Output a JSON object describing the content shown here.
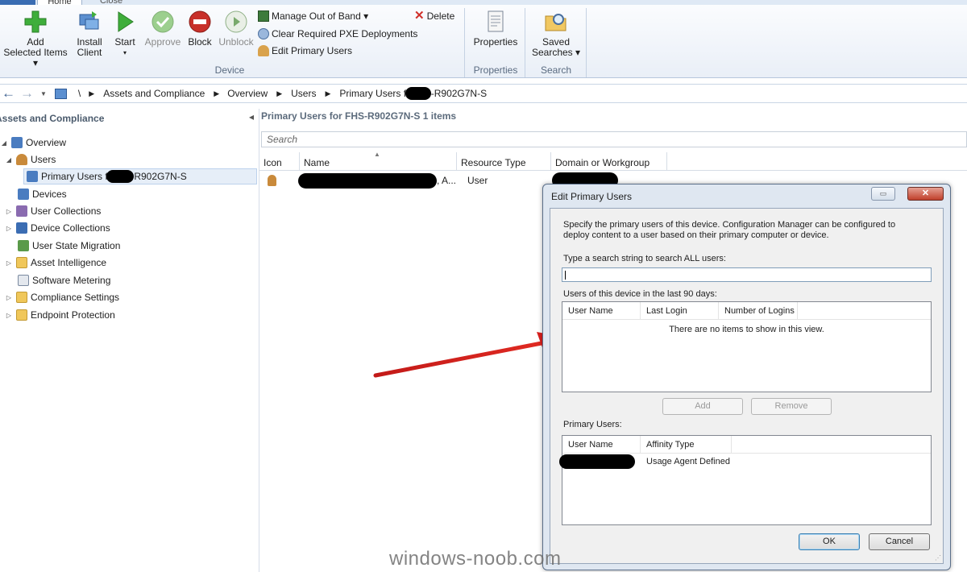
{
  "ribbon": {
    "tabs": [
      "Home",
      "Close"
    ],
    "buttons": {
      "add": "Add",
      "add2": "Selected Items ▾",
      "install": "Install",
      "install2": "Client",
      "start": "Start",
      "start2": "▾",
      "approve": "Approve",
      "block": "Block",
      "unblock": "Unblock"
    },
    "small_commands": {
      "manage_oob": "Manage Out of Band ▾",
      "clear_pxe": "Clear Required PXE Deployments",
      "edit_primary": "Edit Primary Users",
      "delete": "Delete"
    },
    "properties": "Properties",
    "saved_searches": "Saved",
    "saved_searches2": "Searches ▾",
    "groups": {
      "device": "Device",
      "properties": "Properties",
      "search": "Search"
    }
  },
  "addressbar": {
    "nav_back": "←",
    "nav_forward": "→",
    "root": "\\",
    "crumbs": [
      "Assets and Compliance",
      "Overview",
      "Users"
    ],
    "last_crumb_prefix": "Primary Users fo",
    "last_crumb_suffix": "-R902G7N-S"
  },
  "leftpane": {
    "header": "Assets and Compliance",
    "collapse": "◂",
    "items": [
      {
        "label": "Overview",
        "icon": "overview-icon",
        "color": "#4a7cc0"
      },
      {
        "label": "Users",
        "icon": "users-icon",
        "color": "#c98a3b"
      },
      {
        "label_prefix": "Primary Users fo",
        "label_suffix": "R902G7N-S",
        "icon": "primary-users-icon",
        "color": "#4a7cc0"
      },
      {
        "label": "Devices",
        "icon": "devices-icon",
        "color": "#4a7cc0"
      },
      {
        "label": "User Collections",
        "icon": "user-collections-icon",
        "color": "#8a6bb0"
      },
      {
        "label": "Device Collections",
        "icon": "device-collections-icon",
        "color": "#3b6db3"
      },
      {
        "label": "User State Migration",
        "icon": "user-state-migration-icon",
        "color": "#5a9a4a"
      },
      {
        "label": "Asset Intelligence",
        "icon": "folder-icon",
        "color": "#f0c75a"
      },
      {
        "label": "Software Metering",
        "icon": "software-metering-icon",
        "color": "#7a8aa0"
      },
      {
        "label": "Compliance Settings",
        "icon": "folder-icon",
        "color": "#f0c75a"
      },
      {
        "label": "Endpoint Protection",
        "icon": "folder-icon",
        "color": "#f0c75a"
      }
    ]
  },
  "main": {
    "header": "Primary Users for FHS-R902G7N-S 1 items",
    "search_placeholder": "Search",
    "columns": [
      "Icon",
      "Name",
      "Resource Type",
      "Domain or Workgroup"
    ],
    "rows": [
      {
        "name_suffix": ", A...",
        "resource_type": "User"
      }
    ]
  },
  "dialog": {
    "title": "Edit Primary Users",
    "close": "✕",
    "restore": "▭",
    "description": "Specify the primary users of this device. Configuration Manager can be configured to deploy content to a user based on their primary computer or device.",
    "search_label": "Type a search string to search ALL users:",
    "search_value": "",
    "recent_label": "Users of this device in the last 90 days:",
    "recent_columns": [
      "User Name",
      "Last Login",
      "Number of Logins"
    ],
    "recent_empty": "There are no items to show in this view.",
    "add_button": "Add",
    "remove_button": "Remove",
    "primary_label": "Primary Users:",
    "primary_columns": [
      "User Name",
      "Affinity Type"
    ],
    "primary_rows": [
      {
        "affinity": "Usage Agent Defined"
      }
    ],
    "ok_button": "OK",
    "cancel_button": "Cancel"
  },
  "watermark": "windows-noob.com",
  "colors": {
    "arrow": "#d9201e",
    "redaction": "#000000"
  }
}
